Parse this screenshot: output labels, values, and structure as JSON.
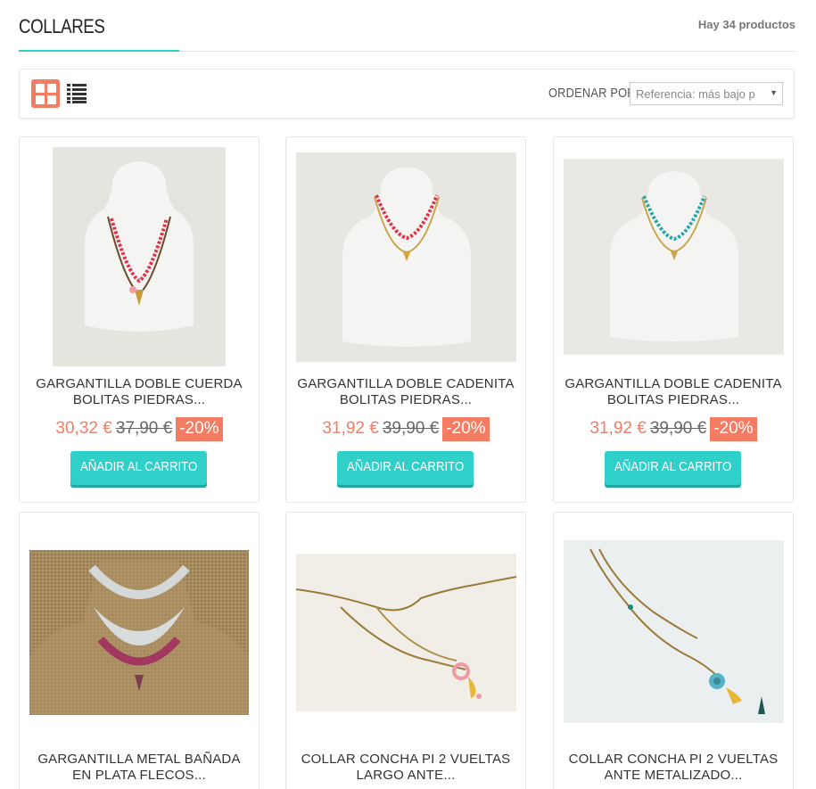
{
  "header": {
    "title": "COLLARES",
    "count": "Hay 34 productos"
  },
  "toolbar": {
    "grid_icon": "grid-view-icon",
    "list_icon": "list-view-icon",
    "sort_label": "ORDENAR POR",
    "sort_value": "Referencia: más bajo p"
  },
  "products": [
    {
      "name": "GARGANTILLA DOBLE CUERDA BOLITAS PIEDRAS...",
      "price": "30,32 €",
      "old_price": "37,90 €",
      "discount": "-20%",
      "button": "AÑADIR AL CARRITO"
    },
    {
      "name": "GARGANTILLA DOBLE CADENITA BOLITAS PIEDRAS...",
      "price": "31,92 €",
      "old_price": "39,90 €",
      "discount": "-20%",
      "button": "AÑADIR AL CARRITO"
    },
    {
      "name": "GARGANTILLA DOBLE CADENITA BOLITAS PIEDRAS...",
      "price": "31,92 €",
      "old_price": "39,90 €",
      "discount": "-20%",
      "button": "AÑADIR AL CARRITO"
    },
    {
      "name": "GARGANTILLA METAL BAÑADA EN PLATA FLECOS..."
    },
    {
      "name": "COLLAR CONCHA PI 2 VUELTAS LARGO ANTE..."
    },
    {
      "name": "COLLAR CONCHA PI 2 VUELTAS ANTE METALIZADO..."
    }
  ],
  "colors": {
    "accent": "#2fd0c9",
    "price": "#f47c63"
  }
}
